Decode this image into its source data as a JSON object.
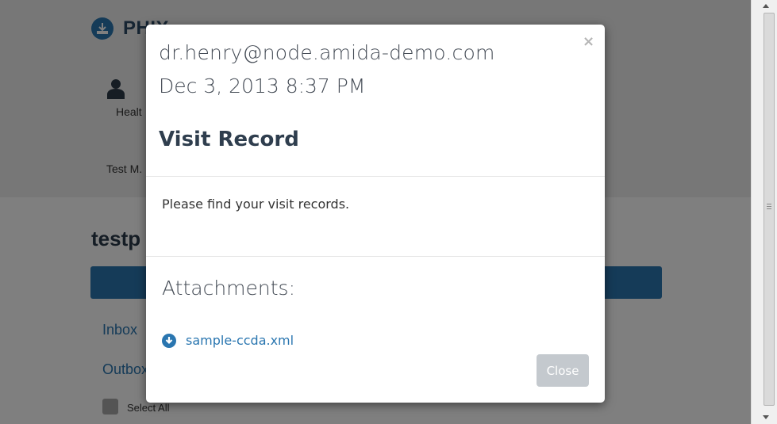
{
  "background": {
    "brand_text": "PHIX",
    "health_label": "Healt",
    "user_label": "Test M.",
    "page_title": "testp",
    "nav": {
      "inbox": "Inbox",
      "outbox": "Outbox"
    },
    "select_all_label": "Select All"
  },
  "modal": {
    "close_x": "×",
    "from": "dr.henry@node.amida-demo.com",
    "date": "Dec 3, 2013 8:37 PM",
    "subject": "Visit Record",
    "body": "Please find your visit records.",
    "attachments_heading": "Attachments:",
    "attachments": [
      {
        "name": "sample-ccda.xml",
        "icon": "download-icon"
      }
    ],
    "close_button": "Close"
  },
  "colors": {
    "accent": "#2a76b0",
    "overlay": "rgba(0,0,0,0.5)",
    "close_button_bg": "#c4c9ce"
  }
}
